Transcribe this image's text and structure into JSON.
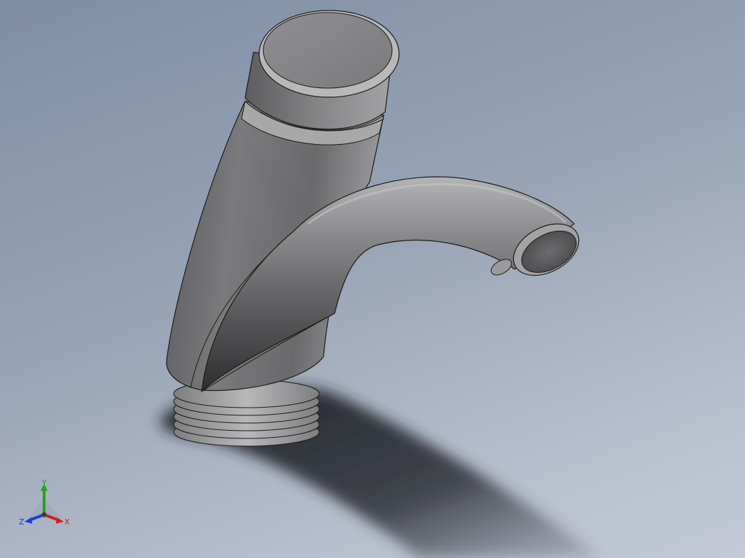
{
  "view": {
    "background_top": "#7f8ea5",
    "background_bottom": "#c3cad6",
    "model_color": "#8a8a8c",
    "edge_color": "#1a1a1a"
  },
  "triad": {
    "x_label": "X",
    "y_label": "Y",
    "z_label": "Z",
    "x_color": "#d21e1e",
    "y_color": "#1fa51f",
    "z_color": "#1e3ccf"
  }
}
